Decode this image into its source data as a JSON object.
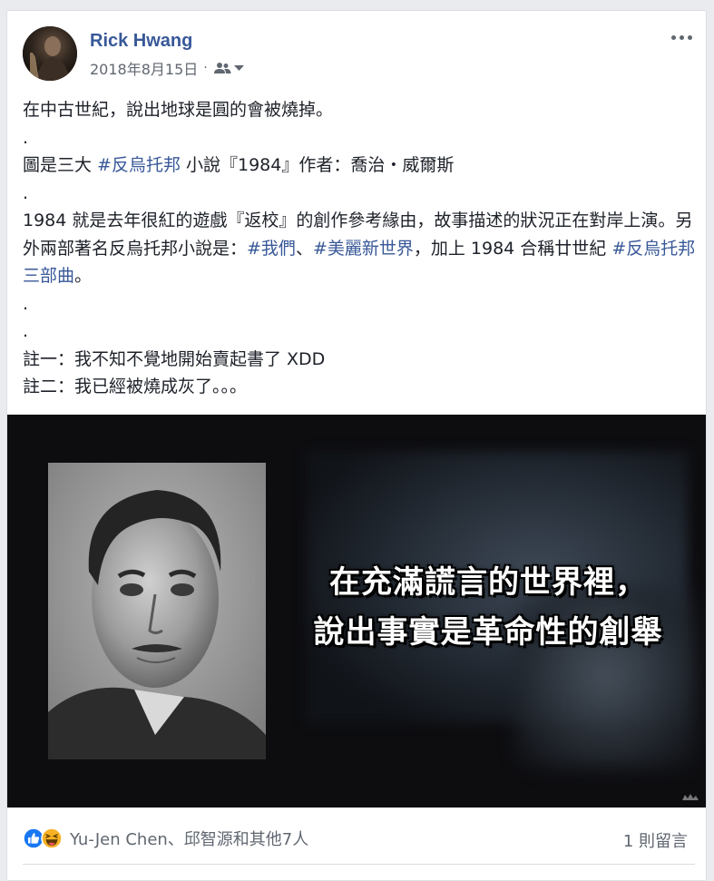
{
  "post": {
    "author": "Rick Hwang",
    "date": "2018年8月15日",
    "meta_separator": "·",
    "privacy_icon": "friends-icon",
    "menu_icon": "more-options-icon",
    "lines": [
      {
        "segments": [
          {
            "text": "在中古世紀，說出地球是圓的會被燒掉。"
          }
        ]
      },
      {
        "segments": [
          {
            "text": "."
          }
        ]
      },
      {
        "segments": [
          {
            "text": "圖是三大 "
          },
          {
            "text": "#反烏托邦",
            "hashtag": true
          },
          {
            "text": " 小說『1984』作者：喬治・威爾斯"
          }
        ]
      },
      {
        "segments": [
          {
            "text": "."
          }
        ]
      },
      {
        "wrap": true,
        "segments": [
          {
            "text": "1984 就是去年很紅的遊戲『返校』的創作參考緣由，故事描述的狀況正在對岸上演。另外兩部著名反烏托邦小說是："
          },
          {
            "text": "#我們",
            "hashtag": true
          },
          {
            "text": "、"
          },
          {
            "text": "#美麗新世界",
            "hashtag": true
          },
          {
            "text": "，加上 1984 合稱廿世紀 "
          },
          {
            "text": "#反烏托邦三部曲",
            "hashtag": true
          },
          {
            "text": "。"
          }
        ]
      },
      {
        "segments": [
          {
            "text": "."
          }
        ]
      },
      {
        "segments": [
          {
            "text": "."
          }
        ]
      },
      {
        "segments": [
          {
            "text": "註一：我不知不覺地開始賣起書了 XDD"
          }
        ]
      },
      {
        "segments": [
          {
            "text": "註二：我已經被燒成灰了。。。"
          }
        ]
      }
    ]
  },
  "media": {
    "caption_line1": "在充滿謊言的世界裡，",
    "caption_line2": "說出事實是革命性的創舉"
  },
  "footer": {
    "reaction_icons": [
      "like-icon",
      "haha-icon"
    ],
    "reactors": "Yu-Jen Chen、邱智源和其他7人",
    "comments": "1 則留言"
  },
  "colors": {
    "link": "#385898",
    "text": "#1d2129",
    "secondary": "#616770",
    "like_blue": "#1877f2",
    "haha_yellow": "#f7b125"
  }
}
